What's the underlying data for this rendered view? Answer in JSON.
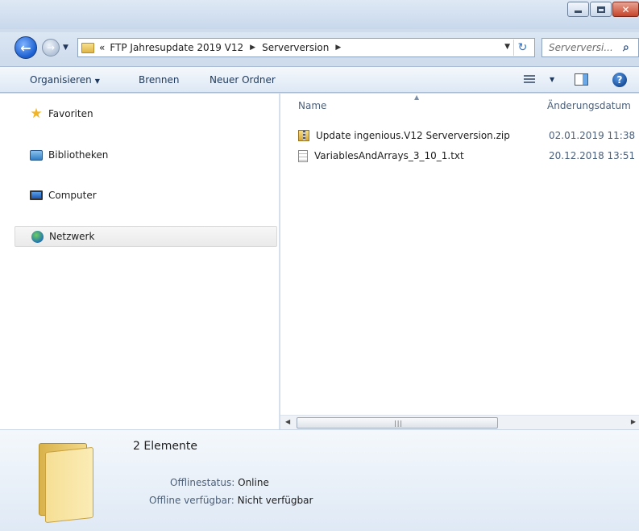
{
  "window": {
    "buttons": {
      "minimize": "minimize",
      "maximize": "maximize",
      "close": "x"
    }
  },
  "address": {
    "overflow": "«",
    "crumbs": [
      "FTP Jahresupdate 2019 V12",
      "Serverversion"
    ],
    "search_placeholder": "Serverversi..."
  },
  "toolbar": {
    "organize": "Organisieren",
    "burn": "Brennen",
    "new_folder": "Neuer Ordner"
  },
  "nav": {
    "items": [
      {
        "label": "Favoriten",
        "icon": "star-icon"
      },
      {
        "label": "Bibliotheken",
        "icon": "library-icon"
      },
      {
        "label": "Computer",
        "icon": "computer-icon"
      },
      {
        "label": "Netzwerk",
        "icon": "network-icon",
        "selected": true
      }
    ]
  },
  "files": {
    "columns": {
      "name": "Name",
      "date": "Änderungsdatum"
    },
    "rows": [
      {
        "name": "Update ingenious.V12 Serverversion.zip",
        "date": "02.01.2019 11:38",
        "icon": "zip-folder-icon"
      },
      {
        "name": "VariablesAndArrays_3_10_1.txt",
        "date": "20.12.2018 13:51",
        "icon": "text-file-icon"
      }
    ]
  },
  "details": {
    "count": "2 Elemente",
    "offline_status_label": "Offlinestatus:",
    "offline_status_value": "Online",
    "offline_available_label": "Offline verfügbar:",
    "offline_available_value": "Nicht verfügbar"
  },
  "colors": {
    "accent": "#1e395b",
    "window_bg": "#cfdcec",
    "close_button": "#c7432a"
  }
}
